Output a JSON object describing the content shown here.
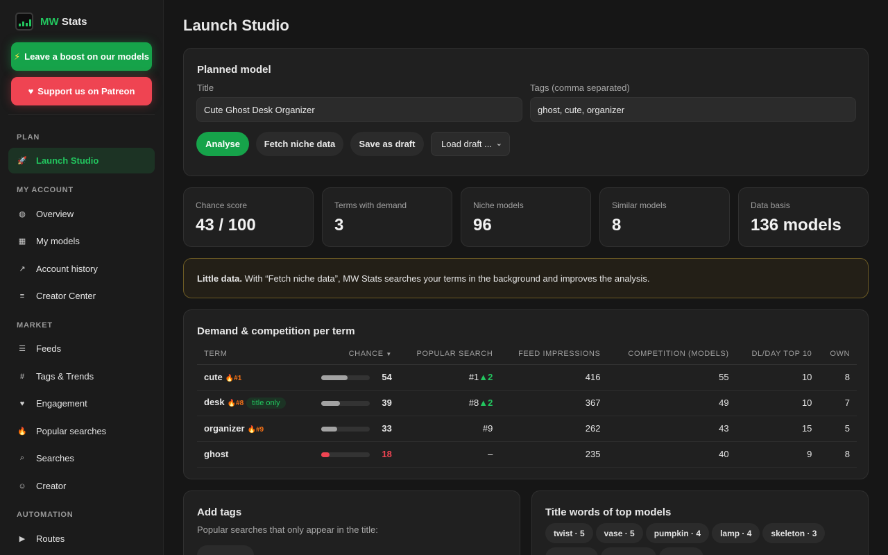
{
  "brand": {
    "name_accent": "MW",
    "name_rest": "Stats"
  },
  "sidebar": {
    "boost_label": "Leave a boost on our models",
    "patreon_label": "Support us on Patreon",
    "sections": {
      "plan": "PLAN",
      "account": "MY ACCOUNT",
      "market": "MARKET",
      "automation": "AUTOMATION"
    },
    "items": [
      {
        "label": "Launch Studio",
        "icon": "rocket-icon"
      },
      {
        "label": "Overview",
        "icon": "dashboard-icon"
      },
      {
        "label": "My models",
        "icon": "grid-icon"
      },
      {
        "label": "Account history",
        "icon": "trend-icon"
      },
      {
        "label": "Creator Center",
        "icon": "list-icon"
      },
      {
        "label": "Feeds",
        "icon": "menu-icon"
      },
      {
        "label": "Tags & Trends",
        "icon": "hash-icon"
      },
      {
        "label": "Engagement",
        "icon": "heart-icon"
      },
      {
        "label": "Popular searches",
        "icon": "fire-icon"
      },
      {
        "label": "Searches",
        "icon": "search-icon"
      },
      {
        "label": "Creator",
        "icon": "smile-icon"
      },
      {
        "label": "Routes",
        "icon": "play-icon"
      }
    ]
  },
  "page": {
    "title": "Launch Studio"
  },
  "planned": {
    "heading": "Planned model",
    "title_label": "Title",
    "title_value": "Cute Ghost Desk Organizer",
    "tags_label": "Tags (comma separated)",
    "tags_value": "ghost, cute, organizer",
    "analyse_label": "Analyse",
    "fetch_label": "Fetch niche data",
    "save_label": "Save as draft",
    "load_label": "Load draft ..."
  },
  "stats": [
    {
      "label": "Chance score",
      "value": "43 / 100"
    },
    {
      "label": "Terms with demand",
      "value": "3"
    },
    {
      "label": "Niche models",
      "value": "96"
    },
    {
      "label": "Similar models",
      "value": "8"
    },
    {
      "label": "Data basis",
      "value": "136 models"
    }
  ],
  "notice": {
    "bold": "Little data.",
    "text": " With “Fetch niche data”, MW Stats searches your terms in the background and improves the analysis."
  },
  "demand": {
    "heading": "Demand & competition per term",
    "columns": {
      "term": "TERM",
      "chance": "CHANCE",
      "popular": "POPULAR SEARCH",
      "feed": "FEED IMPRESSIONS",
      "competition": "COMPETITION (MODELS)",
      "dl": "DL/DAY TOP 10",
      "own": "OWN"
    },
    "rows": [
      {
        "term": "cute",
        "rank": "#1",
        "pill": "",
        "chance": "54",
        "popular": "#1",
        "delta": "▲2",
        "feed": "416",
        "competition": "55",
        "dl": "10",
        "own": "8"
      },
      {
        "term": "desk",
        "rank": "#8",
        "pill": "title only",
        "chance": "39",
        "popular": "#8",
        "delta": "▲2",
        "feed": "367",
        "competition": "49",
        "dl": "10",
        "own": "7"
      },
      {
        "term": "organizer",
        "rank": "#9",
        "pill": "",
        "chance": "33",
        "popular": "#9",
        "delta": "",
        "feed": "262",
        "competition": "43",
        "dl": "15",
        "own": "5"
      },
      {
        "term": "ghost",
        "rank": "",
        "pill": "",
        "chance": "18",
        "popular": "–",
        "delta": "",
        "feed": "235",
        "competition": "40",
        "dl": "9",
        "own": "8"
      }
    ]
  },
  "add_tags": {
    "heading": "Add tags",
    "sub": "Popular searches that only appear in the title:"
  },
  "title_words": {
    "heading": "Title words of top models",
    "chips": [
      "twist · 5",
      "vase · 5",
      "pumpkin · 4",
      "lamp · 4",
      "skeleton · 3"
    ]
  }
}
